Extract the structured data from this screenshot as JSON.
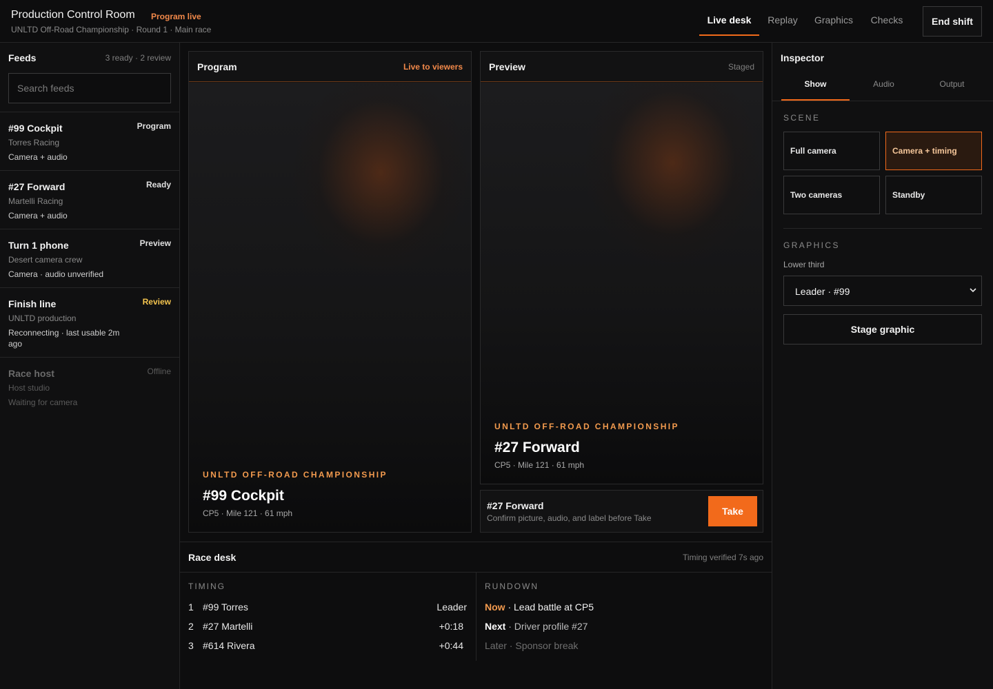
{
  "header": {
    "title": "Production Control Room",
    "live_tag": "Program live",
    "subtitle": "UNLTD Off-Road Championship · Round 1 · Main race",
    "tabs": [
      {
        "label": "Live desk",
        "active": true
      },
      {
        "label": "Replay"
      },
      {
        "label": "Graphics"
      },
      {
        "label": "Checks"
      }
    ],
    "end_shift": "End shift"
  },
  "sidebar": {
    "title": "Feeds",
    "count": "3 ready · 2 review",
    "search_placeholder": "Search feeds",
    "feeds": [
      {
        "name": "#99 Cockpit",
        "status": "Program",
        "org": "Torres Racing",
        "meta": "Camera + audio"
      },
      {
        "name": "#27 Forward",
        "status": "Ready",
        "org": "Martelli Racing",
        "meta": "Camera + audio"
      },
      {
        "name": "Turn 1 phone",
        "status": "Preview",
        "org": "Desert camera crew",
        "meta": "Camera · audio unverified"
      },
      {
        "name": "Finish line",
        "status": "Review",
        "org": "UNLTD production",
        "meta": "Reconnecting · last usable 2m ago"
      },
      {
        "name": "Race host",
        "status": "Offline",
        "org": "Host studio",
        "meta": "Waiting for camera"
      }
    ]
  },
  "program": {
    "title": "Program",
    "state": "Live to viewers",
    "series": "UNLTD OFF-ROAD CHAMPIONSHIP",
    "name": "#99 Cockpit",
    "meta": "CP5 · Mile 121 · 61 mph"
  },
  "preview": {
    "title": "Preview",
    "state": "Staged",
    "series": "UNLTD OFF-ROAD CHAMPIONSHIP",
    "name": "#27 Forward",
    "meta": "CP5 · Mile 121 · 61 mph"
  },
  "take": {
    "name": "#27 Forward",
    "hint": "Confirm picture, audio, and label before Take",
    "button": "Take"
  },
  "desk": {
    "title": "Race desk",
    "verified": "Timing verified 7s ago",
    "timing_label": "TIMING",
    "timing": [
      {
        "pos": "1",
        "driver": "#99 Torres",
        "gap": "Leader"
      },
      {
        "pos": "2",
        "driver": "#27 Martelli",
        "gap": "+0:18"
      },
      {
        "pos": "3",
        "driver": "#614 Rivera",
        "gap": "+0:44"
      }
    ],
    "rundown_label": "RUNDOWN",
    "rundown": [
      {
        "when": "Now",
        "what": " · Lead battle at CP5"
      },
      {
        "when": "Next",
        "what": " · Driver profile #27"
      },
      {
        "when": "Later",
        "what": " · Sponsor break"
      }
    ]
  },
  "inspector": {
    "title": "Inspector",
    "tabs": [
      {
        "label": "Show",
        "active": true
      },
      {
        "label": "Audio"
      },
      {
        "label": "Output"
      }
    ],
    "scene_label": "SCENE",
    "scenes": [
      {
        "label": "Full camera"
      },
      {
        "label": "Camera + timing",
        "active": true
      },
      {
        "label": "Two cameras"
      },
      {
        "label": "Standby"
      }
    ],
    "graphics_label": "GRAPHICS",
    "lower_third_label": "Lower third",
    "lower_third_value": "Leader · #99",
    "stage_button": "Stage graphic"
  },
  "colors": {
    "accent": "#f26a1b",
    "live": "#f2894a",
    "review": "#f4c44e",
    "background": "#0d0d0e"
  }
}
